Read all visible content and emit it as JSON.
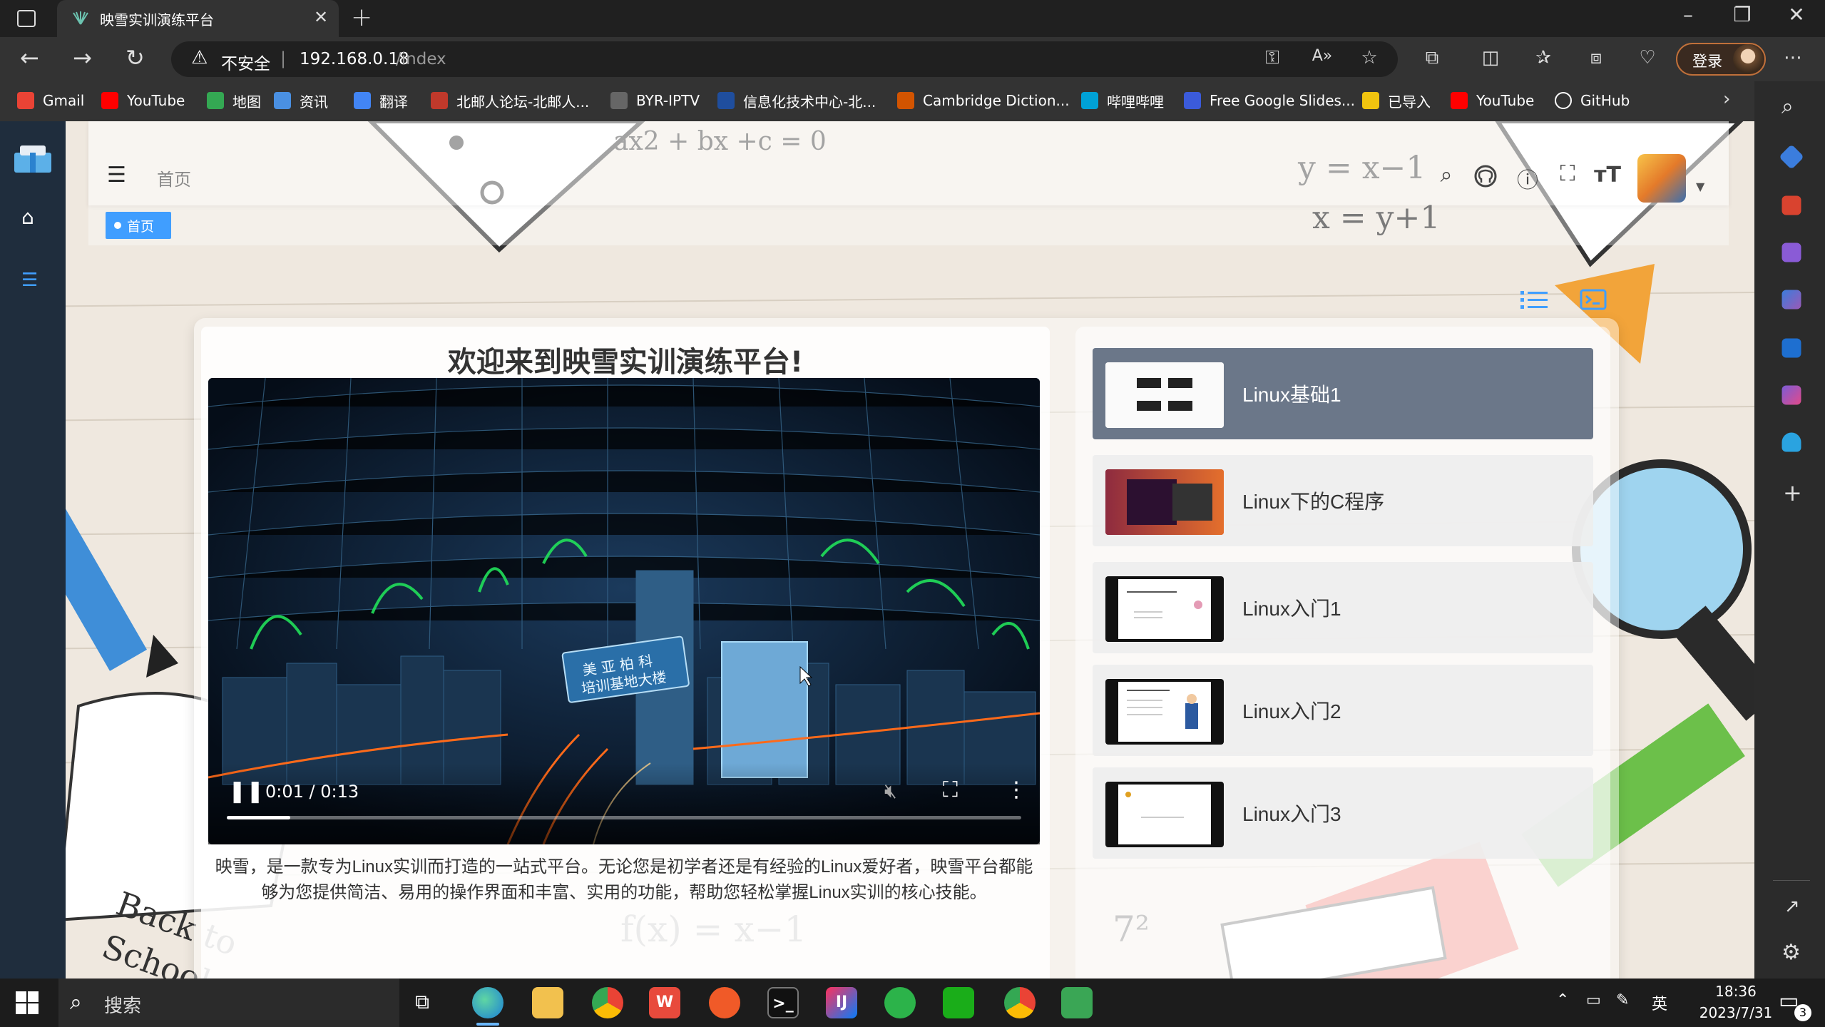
{
  "browser": {
    "tab_title": "映雪实训演练平台",
    "tab_close": "✕",
    "new_tab": "+",
    "address": {
      "warning_label": "不安全",
      "host": "192.168.0.18",
      "path": "/index"
    },
    "login_label": "登录",
    "bookmarks": [
      {
        "label": "Gmail",
        "color": "#ea4335",
        "icon": "gmail-icon"
      },
      {
        "label": "YouTube",
        "color": "#ff0000",
        "icon": "youtube-icon"
      },
      {
        "label": "地图",
        "color": "#34a853",
        "icon": "maps-icon"
      },
      {
        "label": "资讯",
        "color": "#4a90e2",
        "icon": "news-icon"
      },
      {
        "label": "翻译",
        "color": "#4285f4",
        "icon": "translate-icon"
      },
      {
        "label": "北邮人论坛-北邮人...",
        "color": "#c0392b",
        "icon": "byr-icon"
      },
      {
        "label": "BYR-IPTV",
        "color": "#666666",
        "icon": "page-icon"
      },
      {
        "label": "信息化技术中心-北...",
        "color": "#1f4e9e",
        "icon": "bupt-icon"
      },
      {
        "label": "Cambridge Diction...",
        "color": "#d35400",
        "icon": "cambridge-icon"
      },
      {
        "label": "哔哩哔哩",
        "color": "#00a1d6",
        "icon": "bilibili-icon"
      },
      {
        "label": "Free Google Slides...",
        "color": "#3b5bdb",
        "icon": "slides-icon"
      },
      {
        "label": "已导入",
        "color": "#f1c40f",
        "icon": "folder-icon"
      },
      {
        "label": "YouTube",
        "color": "#ff0000",
        "icon": "youtube-icon"
      },
      {
        "label": "GitHub",
        "color": "#ffffff",
        "icon": "github-icon"
      }
    ]
  },
  "app": {
    "breadcrumb_home": "首页",
    "tag_home": "首页",
    "welcome_title": "欢迎来到映雪实训演练平台!",
    "video": {
      "time": "0:01 / 0:13",
      "progress": 0.08,
      "sign_text_line1": "美 亚 柏 科",
      "sign_text_line2": "培训基地大楼"
    },
    "description": "映雪，是一款专为Linux实训而打造的一站式平台。无论您是初学者还是有经验的Linux爱好者，映雪平台都能够为您提供简洁、易用的操作界面和丰富、实用的功能，帮助您轻松掌握Linux实训的核心技能。",
    "courses": [
      {
        "title": "Linux基础1",
        "active": true
      },
      {
        "title": "Linux下的C程序",
        "active": false
      },
      {
        "title": "Linux入门1",
        "active": false
      },
      {
        "title": "Linux入门2",
        "active": false
      },
      {
        "title": "Linux入门3",
        "active": false
      }
    ]
  },
  "taskbar": {
    "search_placeholder": "搜索",
    "ime": "英",
    "time": "18:36",
    "date": "2023/7/31",
    "notification_count": "3"
  },
  "colors": {
    "accent": "#409eff",
    "sidebar": "#1f2d3d",
    "active_course": "#6b7789"
  }
}
